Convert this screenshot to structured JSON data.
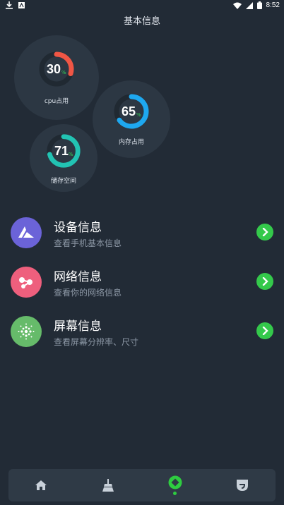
{
  "status": {
    "time": "8:52"
  },
  "page": {
    "title": "基本信息"
  },
  "gauges": [
    {
      "value": "30",
      "unit": "%",
      "label": "cpu占用",
      "percent": 30,
      "color": "#f05645"
    },
    {
      "value": "65",
      "unit": "%",
      "label": "内存占用",
      "percent": 65,
      "color": "#1ea8f0"
    },
    {
      "value": "71",
      "unit": "%",
      "label": "储存空间",
      "percent": 71,
      "color": "#22c3b3"
    }
  ],
  "items": [
    {
      "title": "设备信息",
      "subtitle": "查看手机基本信息",
      "icon": "triangle-logo-icon",
      "color": "#6b63d8"
    },
    {
      "title": "网络信息",
      "subtitle": "查看你的网络信息",
      "icon": "network-nodes-icon",
      "color": "#ee5f7d"
    },
    {
      "title": "屏幕信息",
      "subtitle": "查看屏幕分辨率、尺寸",
      "icon": "screen-dots-icon",
      "color": "#66bb6a"
    }
  ],
  "nav": [
    {
      "icon": "home-icon",
      "active": false
    },
    {
      "icon": "broom-icon",
      "active": false
    },
    {
      "icon": "info-diamond-icon",
      "active": true
    },
    {
      "icon": "shield-icon",
      "active": false
    }
  ],
  "colors": {
    "background": "#222b36",
    "accent_green": "#34c94b"
  }
}
